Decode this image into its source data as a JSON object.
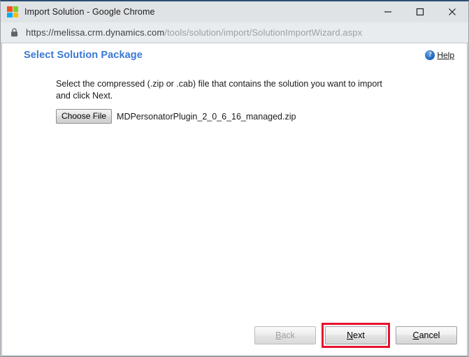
{
  "window": {
    "title": "Import Solution - Google Chrome",
    "app_icon": "microsoft-logo-icon",
    "controls": {
      "minimize": "minimize-icon",
      "maximize": "maximize-icon",
      "close": "close-icon"
    }
  },
  "address_bar": {
    "lock_icon": "lock-icon",
    "url_full": "https://melissa.crm.dynamics.com/tools/solution/import/SolutionImportWizard.aspx",
    "url_origin": "https://melissa.crm.dynamics.com",
    "url_path": "/tools/solution/import/SolutionImportWizard.aspx"
  },
  "page": {
    "title": "Select Solution Package",
    "title_color": "#3a77d4",
    "help": {
      "icon": "help-circle-icon",
      "label_prefix": "H",
      "label_rest": "elp",
      "label": "Help"
    },
    "instructions": "Select the compressed (.zip or .cab) file that contains the solution you want to import and click Next.",
    "file_picker": {
      "button_label": "Choose File",
      "file_name": "MDPersonatorPlugin_2_0_6_16_managed.zip"
    }
  },
  "footer": {
    "highlight_color": "#e8112d",
    "buttons": [
      {
        "name": "back",
        "accel": "B",
        "rest": "ack",
        "label": "Back",
        "disabled": true,
        "highlighted": false
      },
      {
        "name": "next",
        "accel": "N",
        "rest": "ext",
        "label": "Next",
        "disabled": false,
        "highlighted": true
      },
      {
        "name": "cancel",
        "accel": "C",
        "rest": "ancel",
        "label": "Cancel",
        "disabled": false,
        "highlighted": false
      }
    ]
  }
}
